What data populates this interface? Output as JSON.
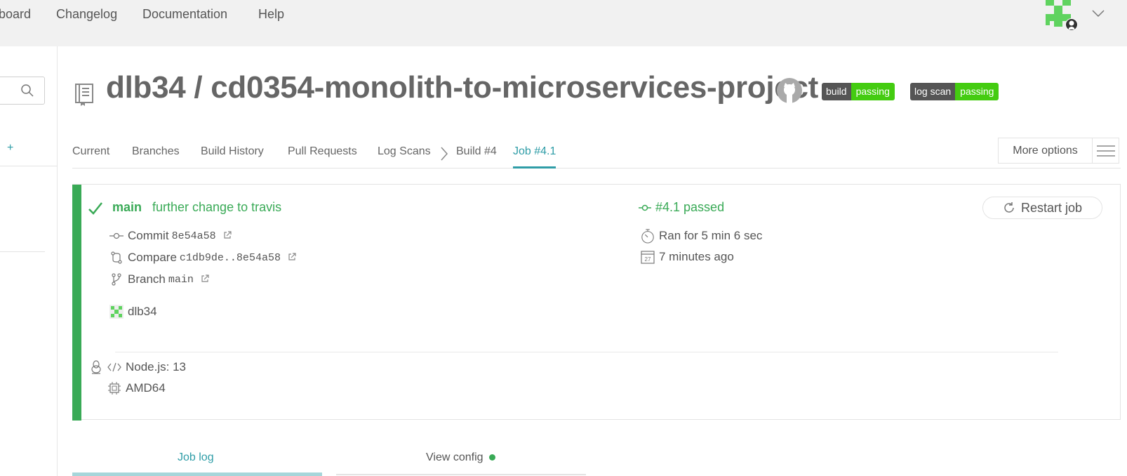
{
  "topnav": {
    "links": [
      "board",
      "Changelog",
      "Documentation",
      "Help"
    ]
  },
  "repo": {
    "owner": "dlb34",
    "name": "cd0354-monolith-to-microservices-project",
    "separator": " / ",
    "badges": [
      {
        "label": "build",
        "status": "passing"
      },
      {
        "label": "log scan",
        "status": "passing"
      }
    ]
  },
  "tabs": {
    "items": [
      "Current",
      "Branches",
      "Build History",
      "Pull Requests",
      "Log Scans"
    ],
    "crumbs": [
      "Build #4",
      "Job #4.1"
    ],
    "more_options": "More options"
  },
  "job": {
    "branch": "main",
    "message": "further change to travis",
    "status": "#4.1 passed",
    "restart": "Restart job",
    "commit_label": "Commit",
    "commit_sha": "8e54a58",
    "compare_label": "Compare",
    "compare_range": "c1db9de..8e54a58",
    "branch_label": "Branch",
    "branch_value": "main",
    "author": "dlb34",
    "duration": "Ran for 5 min 6 sec",
    "time_ago": "7 minutes ago",
    "calendar_day": "27",
    "language": "Node.js: 13",
    "arch": "AMD64"
  },
  "bottom_tabs": {
    "job_log": "Job log",
    "view_config": "View config"
  },
  "colors": {
    "success": "#39aa56",
    "accent": "#2f9da7",
    "badge_dark": "#555555",
    "badge_green": "#44cc11"
  }
}
